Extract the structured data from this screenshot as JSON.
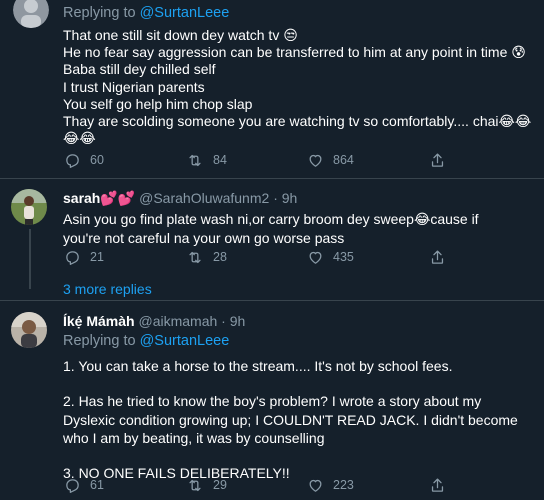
{
  "tweets": [
    {
      "replying_prefix": "Replying to",
      "replying_handle": "@SurtanLeee",
      "lines": [
        "That one still sit down dey watch tv 😒",
        "He no fear say aggression can be transferred to him at any point in time 😰",
        "Baba still dey chilled self",
        "I trust Nigerian parents",
        "You self go help him chop slap",
        "Thay are scolding someone you are watching tv so comfortably.... chai😂😂",
        "😂😂"
      ],
      "replies": "60",
      "retweets": "84",
      "likes": "864"
    },
    {
      "name": "sarah💕💕",
      "handle": "@SarahOluwafunm2",
      "separator": "·",
      "time": "9h",
      "text": "Asin you go find plate wash ni,or carry broom dey sweep😂cause if you're not careful na your own go worse pass",
      "replies": "21",
      "retweets": "28",
      "likes": "435"
    },
    {
      "name": "Íkẹ́ Mámàh",
      "handle": "@aikmamah",
      "separator": "·",
      "time": "9h",
      "replying_prefix": "Replying to",
      "replying_handle": "@SurtanLeee",
      "lines": [
        "1. You can take a horse to the stream.... It's not by school fees.",
        "",
        "2. Has he tried to know the boy's problem? I wrote a story about my Dyslexic condition growing up; I COULDN'T READ JACK. I didn't become who I am by beating, it was by counselling",
        "",
        "3. NO ONE FAILS DELIBERATELY!!"
      ],
      "replies": "61",
      "retweets": "29",
      "likes": "223"
    }
  ],
  "more_replies": "3 more replies",
  "icons": {
    "reply": "reply-icon",
    "retweet": "retweet-icon",
    "like": "heart-icon",
    "share": "share-icon"
  },
  "colors": {
    "background": "#15202b",
    "muted": "#8899a6",
    "link": "#1da1f2",
    "divider": "#38444d"
  }
}
